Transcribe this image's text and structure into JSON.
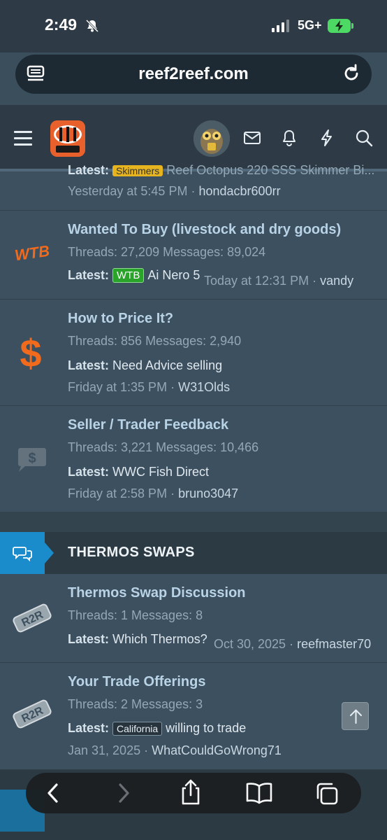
{
  "status_bar": {
    "time": "2:49",
    "network": "5G+",
    "icons": [
      "bell-slash-icon",
      "signal-icon",
      "battery-charging-icon"
    ]
  },
  "browser": {
    "url": "reef2reef.com",
    "icons": [
      "reader-icon",
      "reload-icon"
    ]
  },
  "header": {
    "logo_text": "Reef2Reef",
    "icons": [
      "menu-icon",
      "avatar",
      "envelope-icon",
      "bell-icon",
      "bolt-icon",
      "search-icon"
    ]
  },
  "nodes": [
    {
      "partial": true,
      "latest_prefix": "Latest:",
      "latest_label": "Skimmers",
      "latest_text": "Reef Octopus 220 SSS Skimmer Bi...",
      "meta_time": "Yesterday at 5:45 PM",
      "meta_sep": "·",
      "meta_user": "hondacbr600rr"
    },
    {
      "title": "Wanted To Buy (livestock and dry goods)",
      "stats": "Threads: 27,209 Messages: 89,024",
      "latest_prefix": "Latest:",
      "latest_label": "WTB",
      "latest_text": "Ai Nero 5",
      "meta_time": "Today at 12:31 PM",
      "meta_sep": "·",
      "meta_user": "vandy",
      "icon": "wtb-icon",
      "icon_text": "WTB"
    },
    {
      "title": "How to Price It?",
      "stats": "Threads: 856 Messages: 2,940",
      "latest_prefix": "Latest:",
      "latest_text": "Need Advice selling",
      "meta_time": "Friday at 1:35 PM",
      "meta_sep": "·",
      "meta_user": "W31Olds",
      "icon": "dollar-icon",
      "icon_text": "$"
    },
    {
      "title": "Seller / Trader Feedback",
      "stats": "Threads: 3,221 Messages: 10,466",
      "latest_prefix": "Latest:",
      "latest_text": "WWC Fish Direct",
      "meta_time": "Friday at 2:58 PM",
      "meta_sep": "·",
      "meta_user": "bruno3047",
      "icon": "feedback-dollar-icon",
      "icon_text": "$"
    }
  ],
  "category": {
    "title": "THERMOS SWAPS",
    "icon": "chat-bubbles-icon"
  },
  "thermos_nodes": [
    {
      "title": "Thermos Swap Discussion",
      "stats": "Threads: 1 Messages: 8",
      "latest_prefix": "Latest:",
      "latest_text": "Which Thermos?",
      "meta_time": "Oct 30, 2025",
      "meta_sep": "·",
      "meta_user": "reefmaster70",
      "icon": "r2r-badge-icon",
      "icon_text": "R2R"
    },
    {
      "title": "Your Trade Offerings",
      "stats": "Threads: 2 Messages: 3",
      "latest_prefix": "Latest:",
      "latest_label": "California",
      "latest_text": "willing to trade",
      "meta_time": "Jan 31, 2025",
      "meta_sep": "·",
      "meta_user": "WhatCouldGoWrong71",
      "icon": "r2r-badge-icon",
      "icon_text": "R2R"
    }
  ],
  "toolbar": {
    "icons": [
      "back-icon",
      "forward-icon",
      "share-icon",
      "bookmarks-icon",
      "tabs-icon"
    ]
  },
  "colors": {
    "background": "#3b4e5c",
    "accent_blue": "#1b8ccb",
    "title_blue": "#b9d3e6",
    "wtb_orange": "#f26a1b",
    "label_green": "#2aa32a"
  }
}
